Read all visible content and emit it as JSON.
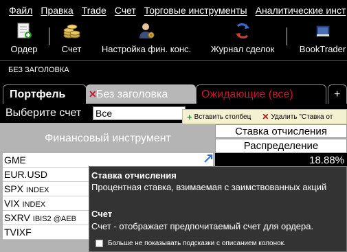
{
  "menu": [
    "Файл",
    "Правка",
    "Trade",
    "Счет",
    "Торговые инструменты",
    "Аналитические инст"
  ],
  "toolbar": {
    "order": "Ордер",
    "account": "Счет",
    "config": "Настройка фин. конс.",
    "tradelog": "Журнал сделок",
    "booktrader": "BookTrader"
  },
  "window_title": "БЕЗ ЗАГОЛОВКА",
  "tabs": {
    "portfolio": "Портфель",
    "untitled": "Без заголовка",
    "pending": "Ожидающие (все)",
    "add": "+"
  },
  "account_select": {
    "label": "Выберите счет",
    "value": "Все"
  },
  "float_toolbar": {
    "insert": "Вставить столбец",
    "remove": "Удалить \"Ставка от"
  },
  "table": {
    "instrument_header": "Финансовый инструмент",
    "col_rate": "Ставка отчисления",
    "col_distribution": "Распределение",
    "rows": [
      {
        "symbol": "GME",
        "sub": ""
      },
      {
        "symbol": "EUR.USD",
        "sub": ""
      },
      {
        "symbol": "SPX",
        "sub": "INDEX"
      },
      {
        "symbol": "VIX",
        "sub": "INDEX"
      },
      {
        "symbol": "SXRV",
        "sub": "IBIS2 @AEB"
      },
      {
        "symbol": "TVIXF",
        "sub": ""
      }
    ],
    "first_value": "18.88%"
  },
  "tooltip": {
    "heading1": "Ставка отчисления",
    "text1": "Процентная ставка, взимаемая с заимствованных акций",
    "heading2": "Счет",
    "text2": "Счет - отображает предпочитаемый счет для ордера.",
    "checkbox_label": "Больше не показывать подсказки с описанием колонок."
  }
}
